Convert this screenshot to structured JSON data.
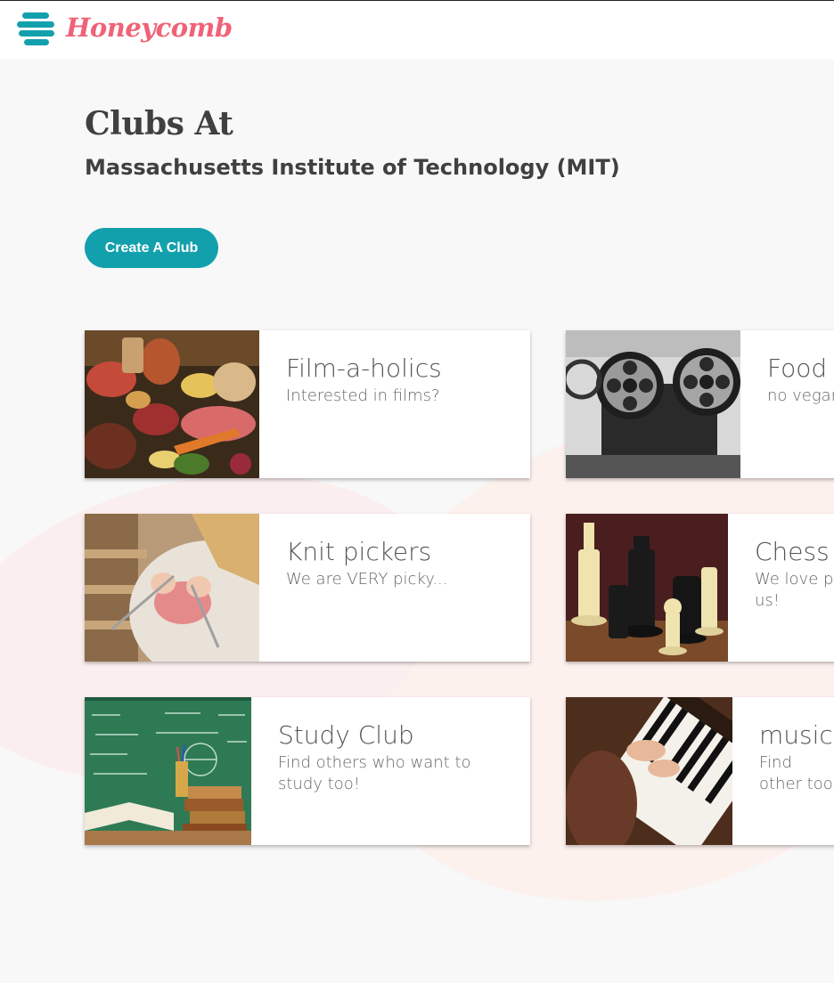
{
  "header": {
    "brand": "Honeycomb",
    "logo_icon": "honeycomb-stack-icon",
    "brand_color": "#f06277",
    "logo_color": "#13a0ad"
  },
  "page": {
    "title": "Clubs At",
    "school": "Massachusetts Institute of Technology (MIT)",
    "create_button_label": "Create A Club",
    "accent_color": "#13a0ad"
  },
  "clubs": [
    {
      "name": "Film-a-holics",
      "description": "Interested in films?",
      "image": "food-photo"
    },
    {
      "name": "Food C",
      "description": "no vegan",
      "image": "film-projector-photo"
    },
    {
      "name": "Knit pickers",
      "description": "We are VERY picky...",
      "image": "knitting-photo"
    },
    {
      "name": "Chess C",
      "description": "We love pl us!",
      "image": "chess-photo"
    },
    {
      "name": "Study Club",
      "description": "Find others who want to study too!",
      "image": "chalkboard-books-photo"
    },
    {
      "name": "music C",
      "description": "Find other too!",
      "image": "piano-photo"
    }
  ]
}
